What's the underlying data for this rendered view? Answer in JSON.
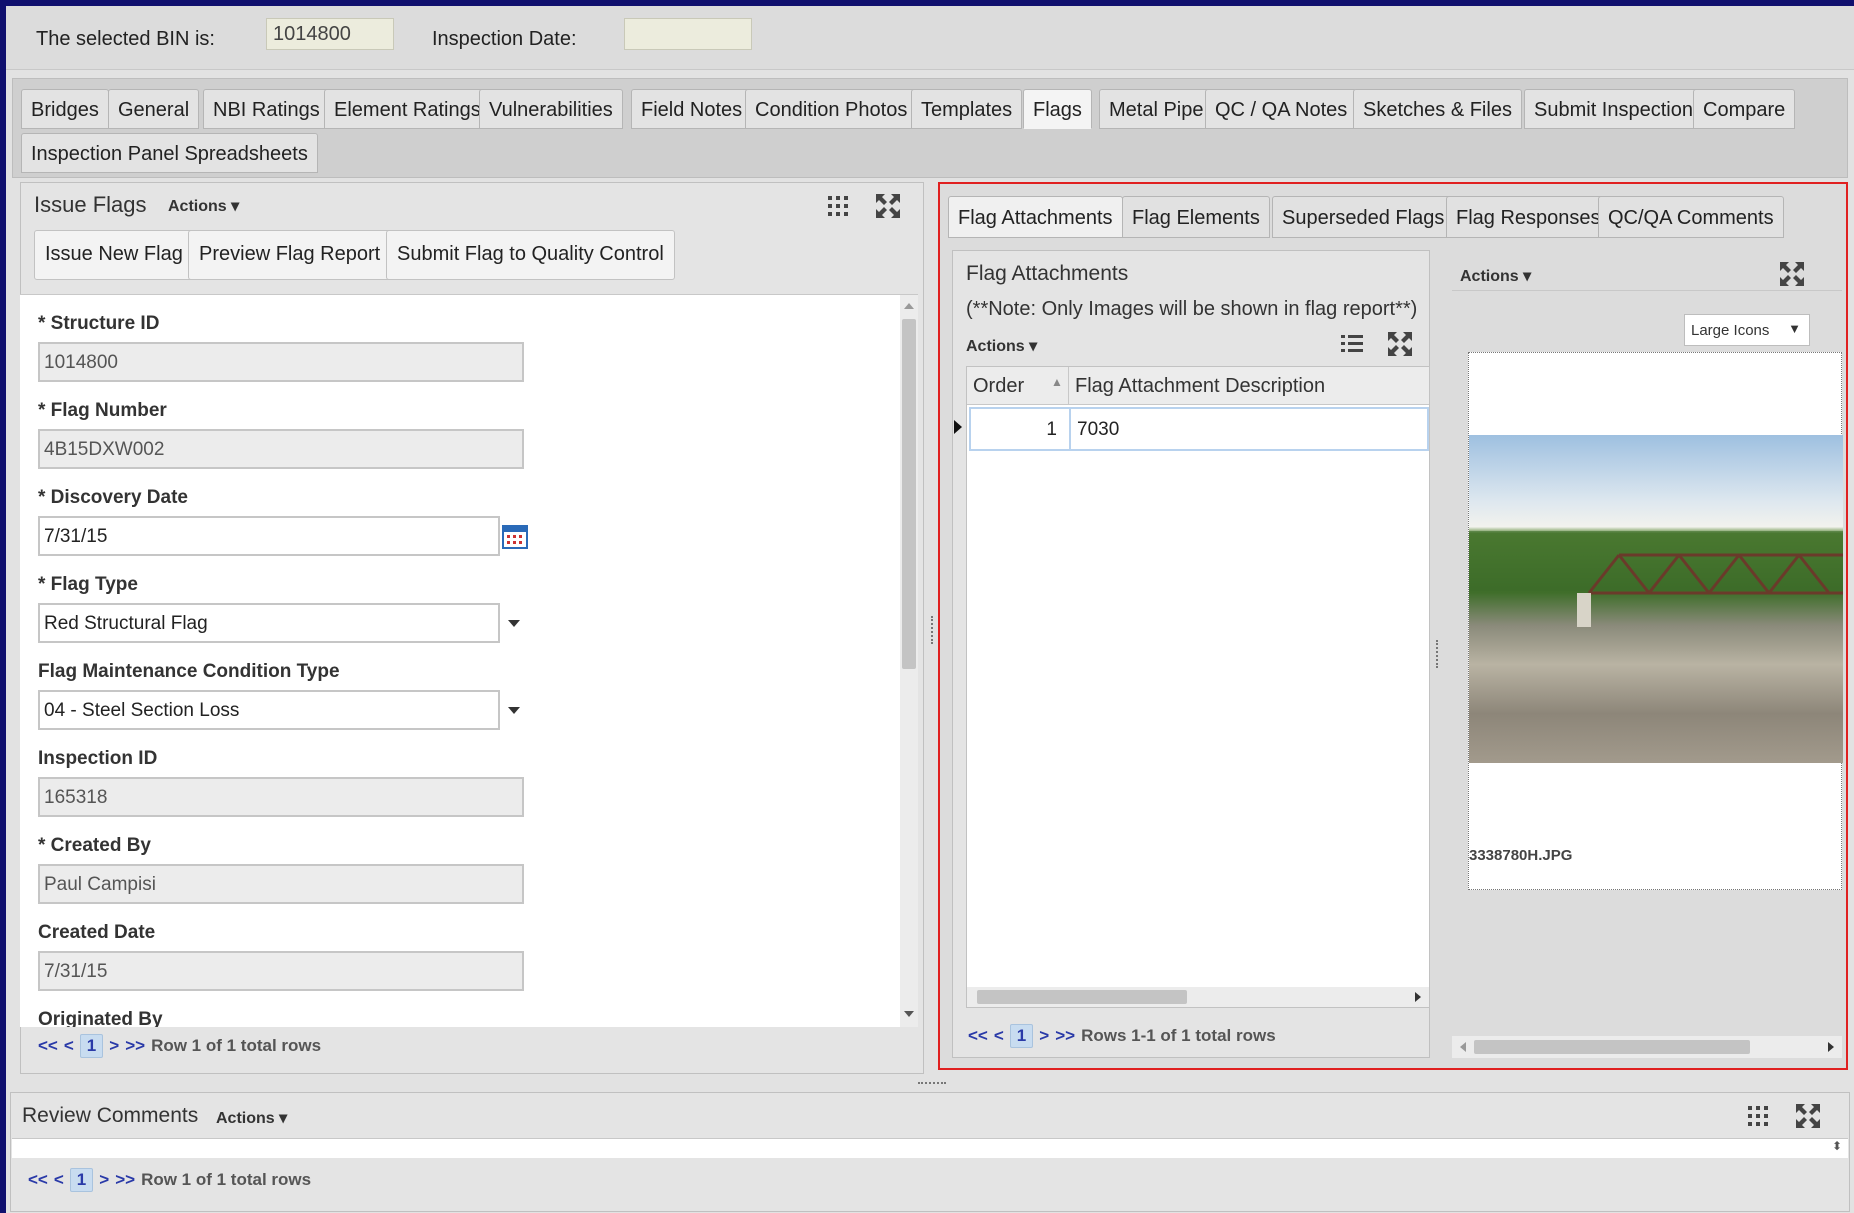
{
  "header": {
    "bin_label": "The selected BIN is:",
    "bin_value": "1014800",
    "inspection_date_label": "Inspection Date:",
    "inspection_date_value": ""
  },
  "main_tabs": [
    {
      "label": "Bridges"
    },
    {
      "label": "General"
    },
    {
      "label": "NBI Ratings"
    },
    {
      "label": "Element Ratings"
    },
    {
      "label": "Vulnerabilities"
    },
    {
      "label": "Field Notes"
    },
    {
      "label": "Condition Photos"
    },
    {
      "label": "Templates"
    },
    {
      "label": "Flags"
    },
    {
      "label": "Metal Pipe"
    },
    {
      "label": "QC / QA Notes"
    },
    {
      "label": "Sketches & Files"
    },
    {
      "label": "Submit Inspection"
    },
    {
      "label": "Compare"
    },
    {
      "label": "Inspection Panel Spreadsheets"
    }
  ],
  "issue_flags": {
    "title": "Issue Flags",
    "actions_label": "Actions ▾",
    "buttons": {
      "issue_new": "Issue New Flag",
      "preview": "Preview Flag Report",
      "submit_qc": "Submit Flag to Quality Control"
    },
    "fields": {
      "structure_id": {
        "label": "* Structure ID",
        "value": "1014800"
      },
      "flag_number": {
        "label": "* Flag Number",
        "value": "4B15DXW002"
      },
      "discovery_date": {
        "label": "* Discovery Date",
        "value": "7/31/15"
      },
      "flag_type": {
        "label": "* Flag Type",
        "value": "Red Structural Flag"
      },
      "maint_condition": {
        "label": "Flag Maintenance Condition Type",
        "value": "04 - Steel Section Loss"
      },
      "inspection_id": {
        "label": "Inspection ID",
        "value": "165318"
      },
      "created_by": {
        "label": "* Created By",
        "value": "Paul Campisi"
      },
      "created_date": {
        "label": "Created Date",
        "value": "7/31/15"
      },
      "originated_by": {
        "label": "Originated By"
      }
    },
    "pager": {
      "first": "<<",
      "prev": "<",
      "page": "1",
      "next": ">",
      "last": ">>",
      "info": "Row 1 of 1 total rows"
    }
  },
  "flag_panel": {
    "tabs": [
      {
        "label": "Flag Attachments"
      },
      {
        "label": "Flag Elements"
      },
      {
        "label": "Superseded Flags"
      },
      {
        "label": "Flag Responses"
      },
      {
        "label": "QC/QA Comments"
      }
    ],
    "attachments": {
      "title": "Flag Attachments",
      "note": "(**Note: Only Images will be shown in flag report**)",
      "actions_label": "Actions ▾",
      "columns": [
        "Order",
        "Flag Attachment Description"
      ],
      "rows": [
        {
          "order": "1",
          "description": "7030"
        }
      ],
      "pager": {
        "first": "<<",
        "prev": "<",
        "page": "1",
        "next": ">",
        "last": ">>",
        "info": "Rows 1-1 of 1 total rows"
      }
    },
    "preview": {
      "actions_label": "Actions ▾",
      "view_mode": "Large Icons",
      "file_name": "3338780H.JPG"
    }
  },
  "review": {
    "title": "Review Comments",
    "actions_label": "Actions ▾",
    "pager": {
      "first": "<<",
      "prev": "<",
      "page": "1",
      "next": ">",
      "last": ">>",
      "info": "Row 1 of 1 total rows"
    }
  },
  "colors": {
    "frame": "#10106e",
    "highlight_border": "#e02020",
    "link": "#2a3aa8"
  }
}
